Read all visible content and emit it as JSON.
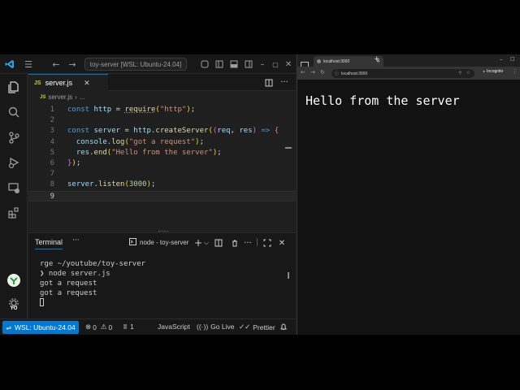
{
  "vscode": {
    "title": "toy-server [WSL: Ubuntu-24.04]",
    "tab": {
      "badge": "JS",
      "label": "server.js"
    },
    "breadcrumb": {
      "badge": "JS",
      "file": "server.js",
      "sep": "›",
      "more": "..."
    },
    "code_lines": [
      {
        "num": "1"
      },
      {
        "num": "2"
      },
      {
        "num": "3"
      },
      {
        "num": "4"
      },
      {
        "num": "5"
      },
      {
        "num": "6"
      },
      {
        "num": "7"
      },
      {
        "num": "8"
      },
      {
        "num": "9"
      }
    ],
    "terminal": {
      "tab_label": "Terminal",
      "more": "···",
      "shell_label": "node - toy-server",
      "output": "rge ~/youtube/toy-server\n❯ node server.js\ngot a request\ngot a request"
    },
    "status": {
      "remote": "WSL: Ubuntu-24.04",
      "errors": "0",
      "warnings": "0",
      "ports": "1",
      "language": "JavaScript",
      "golive": "Go Live",
      "prettier": "Prettier"
    },
    "avatar_text": "YO"
  },
  "browser": {
    "tab_title": "localhost:3000",
    "url": "localhost:3000",
    "profile": "Incognito",
    "content": "Hello from the server"
  },
  "colors": {
    "accent": "#0078d4",
    "editor_bg": "#1f1f1f",
    "chrome_bg": "#181818"
  }
}
